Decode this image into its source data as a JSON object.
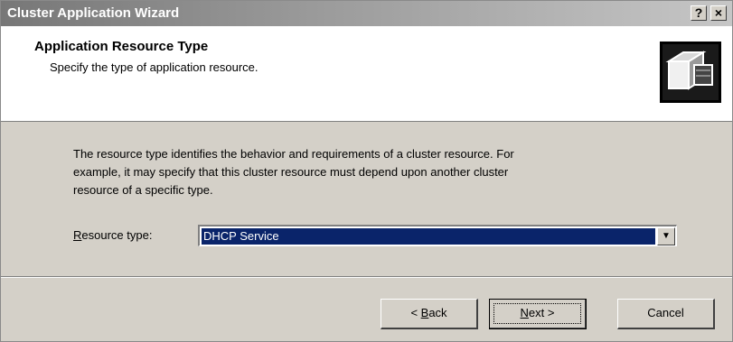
{
  "window": {
    "title": "Cluster Application Wizard",
    "help_glyph": "?",
    "close_glyph": "×"
  },
  "header": {
    "title": "Application Resource Type",
    "subtitle": "Specify the type of application resource.",
    "icon": "cluster-wizard-icon"
  },
  "body": {
    "description_lines": [
      "The resource type identifies the behavior and requirements of a cluster resource. For",
      "example, it may specify that this cluster resource must depend upon another cluster",
      "resource of a specific type."
    ]
  },
  "resource_type": {
    "label_accel": "R",
    "label_rest": "esource type:",
    "selected": "DHCP Service",
    "dropdown_arrow": "▼"
  },
  "buttons": {
    "back_prefix": "< ",
    "back_accel": "B",
    "back_rest": "ack",
    "next_accel": "N",
    "next_rest": "ext >",
    "cancel": "Cancel"
  },
  "colors": {
    "selection": "#0a246a",
    "dialog_face": "#d4d0c8"
  }
}
